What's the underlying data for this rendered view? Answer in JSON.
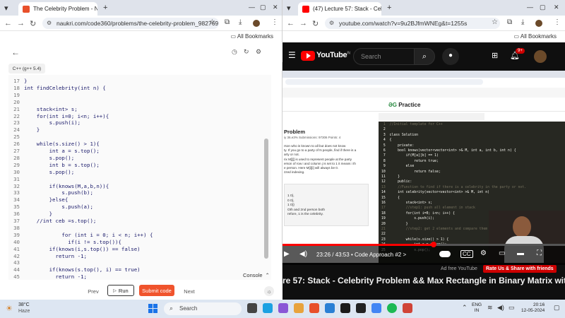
{
  "left_browser": {
    "tab_title": "The Celebrity Problem - Naukri",
    "url": "naukri.com/code360/problems/the-celebrity-problem_982769...",
    "bookmarks_label": "All Bookmarks",
    "language": "C++ (g++ 5.4)",
    "line_numbers": [
      "17",
      "18",
      "19",
      "20",
      "21",
      "22",
      "23",
      "24",
      "25",
      "26",
      "27",
      "28",
      "29",
      "30",
      "31",
      "32",
      "33",
      "34",
      "35",
      "36",
      "37",
      "38",
      "39",
      "40",
      "41",
      "42",
      "43",
      "44",
      "45"
    ],
    "code_lines": [
      "}",
      "int findCelebrity(int n) {",
      "",
      "",
      "    stack<int> s;",
      "    for(int i=0; i<n; i++){",
      "        s.push(i);",
      "    }",
      "",
      "    while(s.size() > 1){",
      "        int a = s.top();",
      "        s.pop();",
      "        int b = s.top();",
      "        s.pop();",
      "",
      "        if(knows(M,a,b,n)){",
      "            s.push(b);",
      "        }else{",
      "            s.push(a);",
      "        }",
      "    //int ceb =s.top();",
      "",
      "            for (int i = 0; i < n; i++) {",
      "              if(i != s.top()){",
      "        if(knows(i,s.top()) == false)",
      "          return -1;",
      "",
      "        if(knows(s.top(), i) == true)",
      "          return -1;"
    ],
    "console_label": "Console",
    "prev_label": "Prev",
    "run_label": "Run",
    "submit_label": "Submit code",
    "next_label": "Next"
  },
  "right_browser": {
    "tab_title": "(47) Lecture 57: Stack - Celebri...",
    "url": "youtube.com/watch?v=9u2BJfmWNEg&t=1255s",
    "bookmarks_label": "All Bookmarks",
    "search_placeholder": "Search",
    "notif_count": "9+",
    "gfg_brand": "Practice",
    "gfg_problem_title": "Problem",
    "gfg_stats": "iy 36.e3%   Submissions: 97306   Points: 4",
    "gfg_desc": "rson who is known to all but does not know\nty. If you go to a party of N people, find if there is a\narty or not.\nrix M[][] is used to represent people at the party\nerson of row i and column j is set to 1 it means i th\ne person. Here M[i][i] will always be 0.\nzzed indexing.",
    "gfg_example": "1 0},\n0 0},\n1 0}}\nOth and 2nd person both\nrefore, 1 is the celebrity.",
    "video_code": [
      "//Initial template for C++",
      "",
      "class Solution",
      "{",
      "    private:",
      "    bool knows(vector<vector<int> >& M, int a, int b, int n) {",
      "        if(M[a][b] == 1)",
      "            return true;",
      "        else",
      "            return false;",
      "    }",
      "    public:",
      "    //Function to find if there is a celebrity in the party or not.",
      "    int celebrity(vector<vector<int> >& M, int n)",
      "    {",
      "        stack<int> s;",
      "        //step1: push all element in stack",
      "        for(int i=0; i<n; i++) {",
      "            s.push(i);",
      "        }",
      "        //step2: get 2 elements and compare them",
      "",
      "        while(s.size() > 1) {",
      "            int a = s.top();",
      "            s.pop();"
    ],
    "video_time": "23:26 / 43:53",
    "chapter": "• Code Approach #2  >",
    "ad_free": "Ad free YouTube",
    "rate_us": "Rate Us & Share with friends",
    "video_title": "re 57: Stack - Celebrity Problem && Max Rectangle in Binary Matrix with"
  },
  "taskbar": {
    "temp": "38°C",
    "weather": "Haze",
    "search_placeholder": "Search",
    "lang1": "ENG",
    "lang2": "IN",
    "time": "20:16",
    "date": "12-05-2024"
  }
}
